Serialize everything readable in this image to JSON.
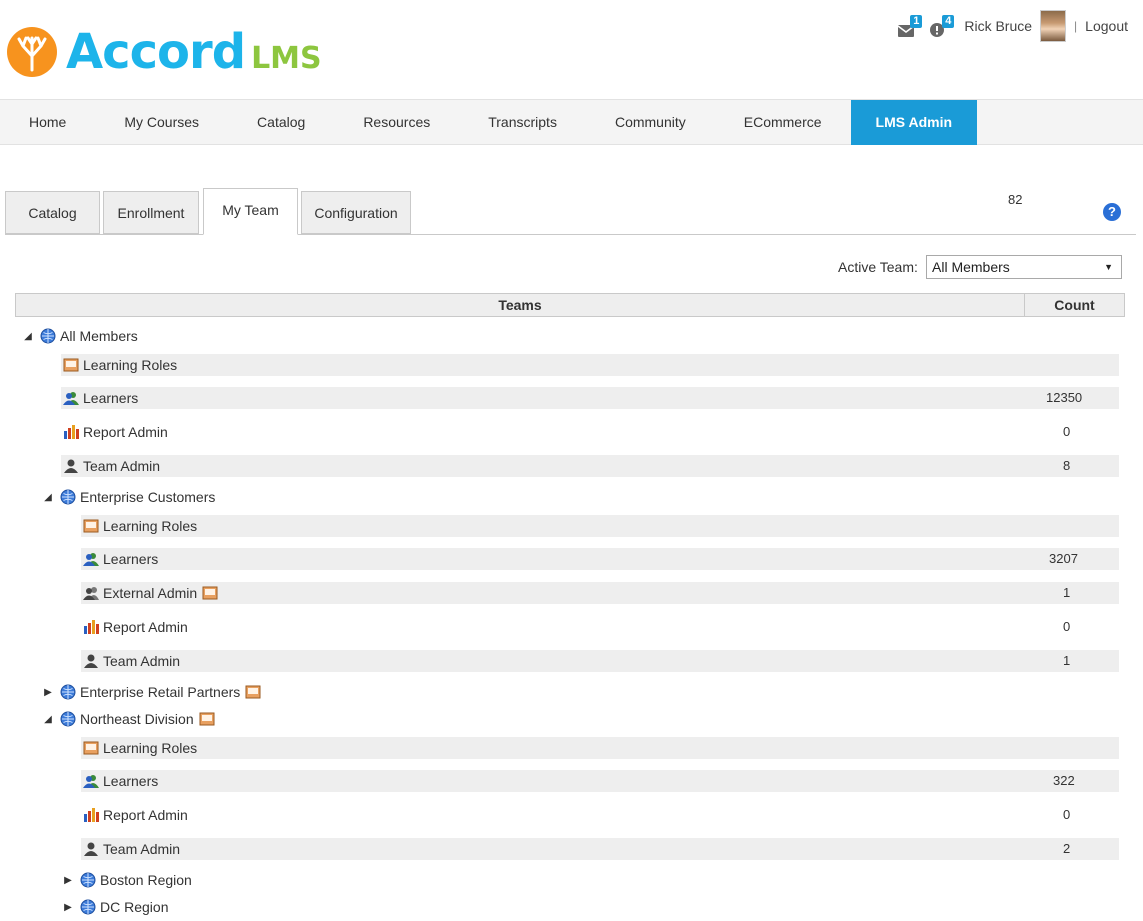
{
  "header": {
    "logo_text": "Accord",
    "logo_suffix": "LMS",
    "messages_count": "1",
    "alerts_count": "4",
    "user_name": "Rick Bruce",
    "separator": "|",
    "logout_label": "Logout"
  },
  "nav": {
    "items": [
      "Home",
      "My Courses",
      "Catalog",
      "Resources",
      "Transcripts",
      "Community",
      "ECommerce",
      "LMS Admin"
    ],
    "active": "LMS Admin"
  },
  "tabs": {
    "items": [
      "Catalog",
      "Enrollment",
      "My Team",
      "Configuration"
    ],
    "active": "My Team",
    "count": "82",
    "help": "?"
  },
  "active_team": {
    "label": "Active Team:",
    "value": "All Members"
  },
  "grid": {
    "col_teams": "Teams",
    "col_count": "Count"
  },
  "tree": {
    "all_members": {
      "label": "All Members",
      "learning_roles": "Learning Roles",
      "learners": "Learners",
      "learners_count": "12350",
      "report_admin": "Report Admin",
      "report_admin_count": "0",
      "team_admin": "Team Admin",
      "team_admin_count": "8"
    },
    "enterprise_customers": {
      "label": "Enterprise Customers",
      "learning_roles": "Learning Roles",
      "learners": "Learners",
      "learners_count": "3207",
      "external_admin": "External Admin",
      "external_admin_count": "1",
      "report_admin": "Report Admin",
      "report_admin_count": "0",
      "team_admin": "Team Admin",
      "team_admin_count": "1"
    },
    "enterprise_retail_partners": {
      "label": "Enterprise Retail Partners"
    },
    "northeast_division": {
      "label": "Northeast Division",
      "learning_roles": "Learning Roles",
      "learners": "Learners",
      "learners_count": "322",
      "report_admin": "Report Admin",
      "report_admin_count": "0",
      "team_admin": "Team Admin",
      "team_admin_count": "2"
    },
    "boston_region": {
      "label": "Boston Region"
    },
    "dc_region": {
      "label": "DC Region"
    }
  },
  "colors": {
    "accent": "#1a9bd7",
    "logo_blue": "#1db4ea",
    "logo_green": "#8dc63f",
    "logo_orange": "#f7931e"
  }
}
